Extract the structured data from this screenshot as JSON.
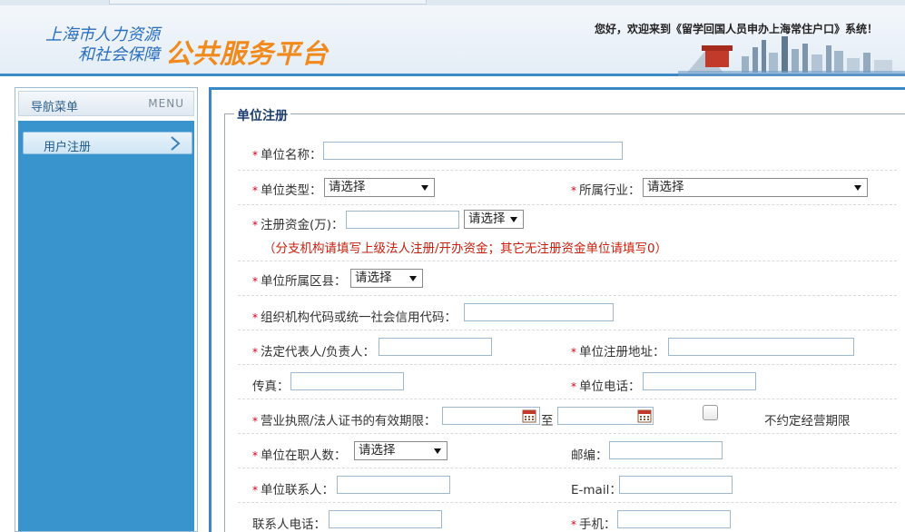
{
  "header": {
    "logo_line1": "上海市人力资源",
    "logo_line2": "和社会保障",
    "platform_title": "公共服务平台",
    "welcome": "您好，欢迎来到《留学回国人员申办上海常住户口》系统！"
  },
  "sidebar": {
    "title": "导航菜单",
    "menu_label": "MENU",
    "items": [
      {
        "label": "用户注册"
      }
    ]
  },
  "form": {
    "legend": "单位注册",
    "unit_name": {
      "label": "单位名称：",
      "value": ""
    },
    "unit_type": {
      "label": "单位类型：",
      "selected": "请选择"
    },
    "industry": {
      "label": "所属行业：",
      "selected": "请选择"
    },
    "capital": {
      "label": "注册资金(万)：",
      "value": "",
      "currency_selected": "请选择",
      "hint": "（分支机构请填写上级法人注册/开办资金；其它无注册资金单位请填写0）"
    },
    "district": {
      "label": "单位所属区县：",
      "selected": "请选择"
    },
    "org_code": {
      "label": "组织机构代码或统一社会信用代码：",
      "value": ""
    },
    "legal_rep": {
      "label": "法定代表人/负责人：",
      "value": ""
    },
    "address": {
      "label": "单位注册地址：",
      "value": ""
    },
    "fax": {
      "label": "传真：",
      "value": ""
    },
    "phone": {
      "label": "单位电话：",
      "value": ""
    },
    "license": {
      "label": "营业执照/法人证书的有效期限：",
      "start": "",
      "to": "至",
      "end": "",
      "no_limit": "不约定经营期限",
      "no_limit_checked": false
    },
    "employees": {
      "label": "单位在职人数：",
      "selected": "请选择"
    },
    "postcode": {
      "label": "邮编：",
      "value": ""
    },
    "contact": {
      "label": "单位联系人：",
      "value": ""
    },
    "email": {
      "label": "E-mail：",
      "value": ""
    },
    "contact_phone": {
      "label": "联系人电话：",
      "value": ""
    },
    "mobile": {
      "label": "手机：",
      "value": ""
    }
  },
  "colors": {
    "accent": "#3a88c4",
    "required": "#d0021b",
    "hint": "#c8200e",
    "logo_orange": "#f08a1c",
    "logo_blue": "#2a6fc0"
  }
}
